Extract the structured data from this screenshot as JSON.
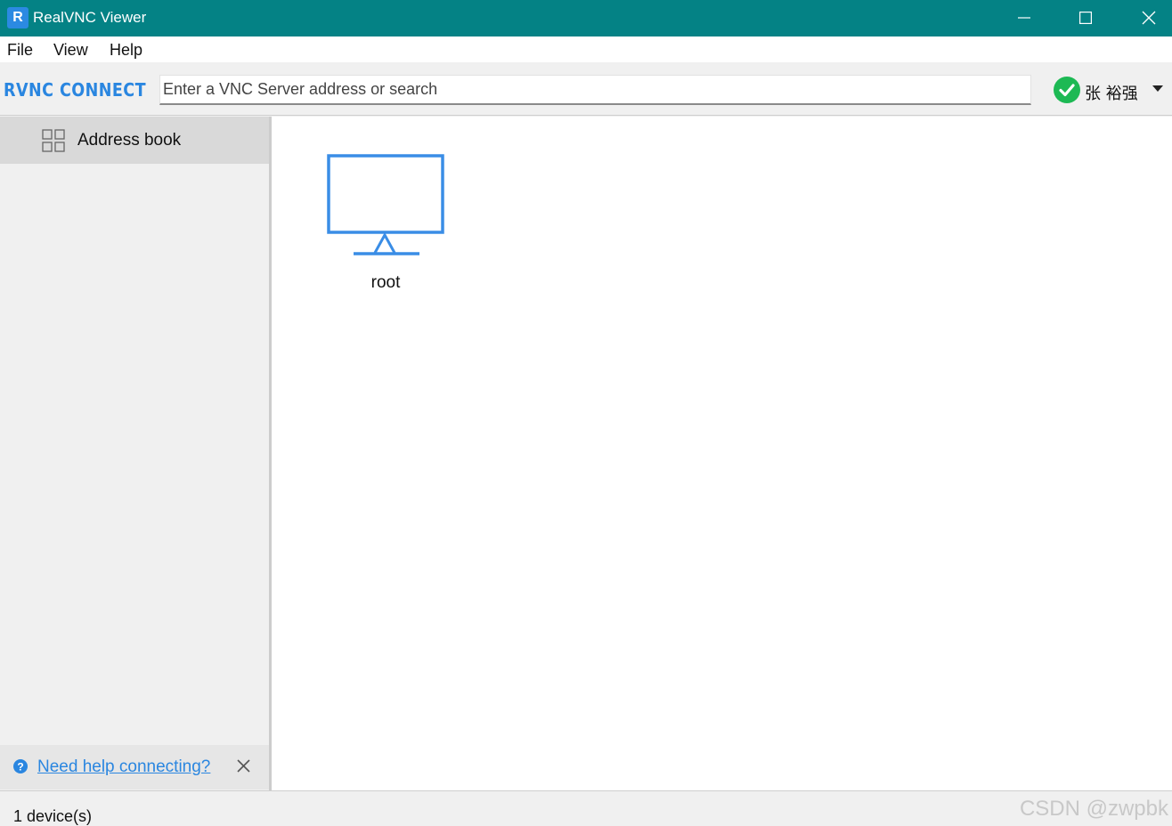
{
  "window": {
    "app_icon_text": "R",
    "title": "RealVNC Viewer",
    "title_bar_color": "#048285"
  },
  "menubar": {
    "items": [
      "File",
      "View",
      "Help"
    ]
  },
  "toolbar": {
    "brand": "RVNC CONNECT",
    "search_placeholder": "Enter a VNC Server address or search",
    "search_value": "",
    "account_name": "张 裕强",
    "account_status": "signed-in"
  },
  "sidebar": {
    "items": [
      {
        "label": "Address book",
        "icon": "grid-icon",
        "selected": true
      }
    ],
    "help_link": "Need help connecting?"
  },
  "main": {
    "devices": [
      {
        "label": "root",
        "icon": "monitor-icon"
      }
    ]
  },
  "statusbar": {
    "device_count": "1 device(s)",
    "watermark": "CSDN @zwpbk"
  },
  "colors": {
    "accent": "#2a86e0",
    "monitor": "#3a8de6",
    "check": "#1db954"
  }
}
